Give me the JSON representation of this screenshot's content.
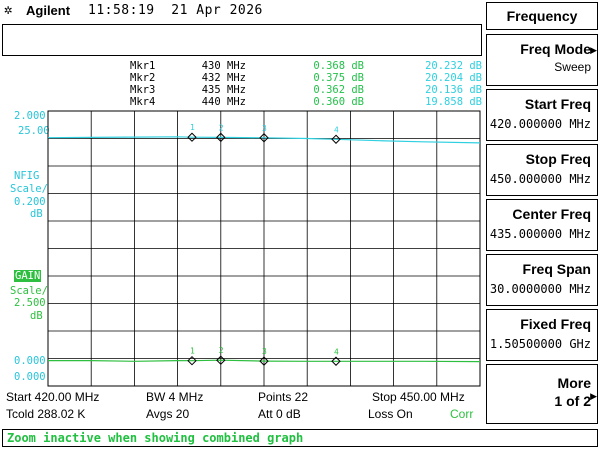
{
  "header": {
    "brand": "Agilent",
    "time": "11:58:19",
    "date": "21 Apr 2026"
  },
  "markers": [
    {
      "name": "Mkr1",
      "freq": "430 MHz",
      "val1": "0.368 dB",
      "val2": "20.232 dB"
    },
    {
      "name": "Mkr2",
      "freq": "432 MHz",
      "val1": "0.375 dB",
      "val2": "20.204 dB"
    },
    {
      "name": "Mkr3",
      "freq": "435 MHz",
      "val1": "0.362 dB",
      "val2": "20.136 dB"
    },
    {
      "name": "Mkr4",
      "freq": "440 MHz",
      "val1": "0.360 dB",
      "val2": "19.858 dB"
    }
  ],
  "axis": {
    "nfig_top": "2.000",
    "gain_top": "25.00",
    "nfig_label": "NFIG",
    "nfig_scale_label": "Scale/",
    "nfig_scale": "0.200",
    "nfig_unit": "dB",
    "gain_label": "GAIN",
    "gain_scale_label": "Scale/",
    "gain_scale": "2.500",
    "gain_unit": "dB",
    "nfig_bottom": "0.000",
    "gain_bottom": "0.000"
  },
  "chart_data": {
    "type": "line",
    "x": [
      420,
      423,
      426,
      429,
      430,
      432,
      435,
      438,
      440,
      443,
      446,
      450
    ],
    "xlim": [
      420,
      450
    ],
    "series": [
      {
        "name": "GAIN",
        "color": "#2fd0e0",
        "ylim": [
          0,
          25
        ],
        "values": [
          20.15,
          20.2,
          20.25,
          20.3,
          20.232,
          20.204,
          20.136,
          20.0,
          19.858,
          19.6,
          19.4,
          19.2
        ]
      },
      {
        "name": "NFIG",
        "color": "#2fbf40",
        "ylim": [
          0,
          2
        ],
        "values": [
          0.37,
          0.37,
          0.36,
          0.37,
          0.368,
          0.375,
          0.362,
          0.36,
          0.36,
          0.36,
          0.36,
          0.355
        ]
      }
    ],
    "markers": [
      {
        "label": "1",
        "x": 430
      },
      {
        "label": "2",
        "x": 432
      },
      {
        "label": "3",
        "x": 435
      },
      {
        "label": "4",
        "x": 440
      }
    ],
    "grid": true
  },
  "footer": {
    "start": "Start 420.00 MHz",
    "bw": "BW 4 MHz",
    "points": "Points 22",
    "stop": "Stop 450.00 MHz",
    "tcold": "Tcold 288.02 K",
    "avgs": "Avgs 20",
    "att": "Att 0 dB",
    "loss": "Loss On",
    "corr": "Corr"
  },
  "status": "Zoom inactive when showing combined graph",
  "softkeys": {
    "title": "Frequency",
    "keys": [
      {
        "label": "Freq Mode",
        "value": "Sweep"
      },
      {
        "label": "Start Freq",
        "value": "420.000000 MHz"
      },
      {
        "label": "Stop Freq",
        "value": "450.000000 MHz"
      },
      {
        "label": "Center Freq",
        "value": "435.000000 MHz"
      },
      {
        "label": "Freq Span",
        "value": "30.0000000 MHz"
      },
      {
        "label": "Fixed Freq",
        "value": "1.50500000 GHz"
      },
      {
        "label": "More",
        "value": "1 of 2"
      }
    ]
  }
}
